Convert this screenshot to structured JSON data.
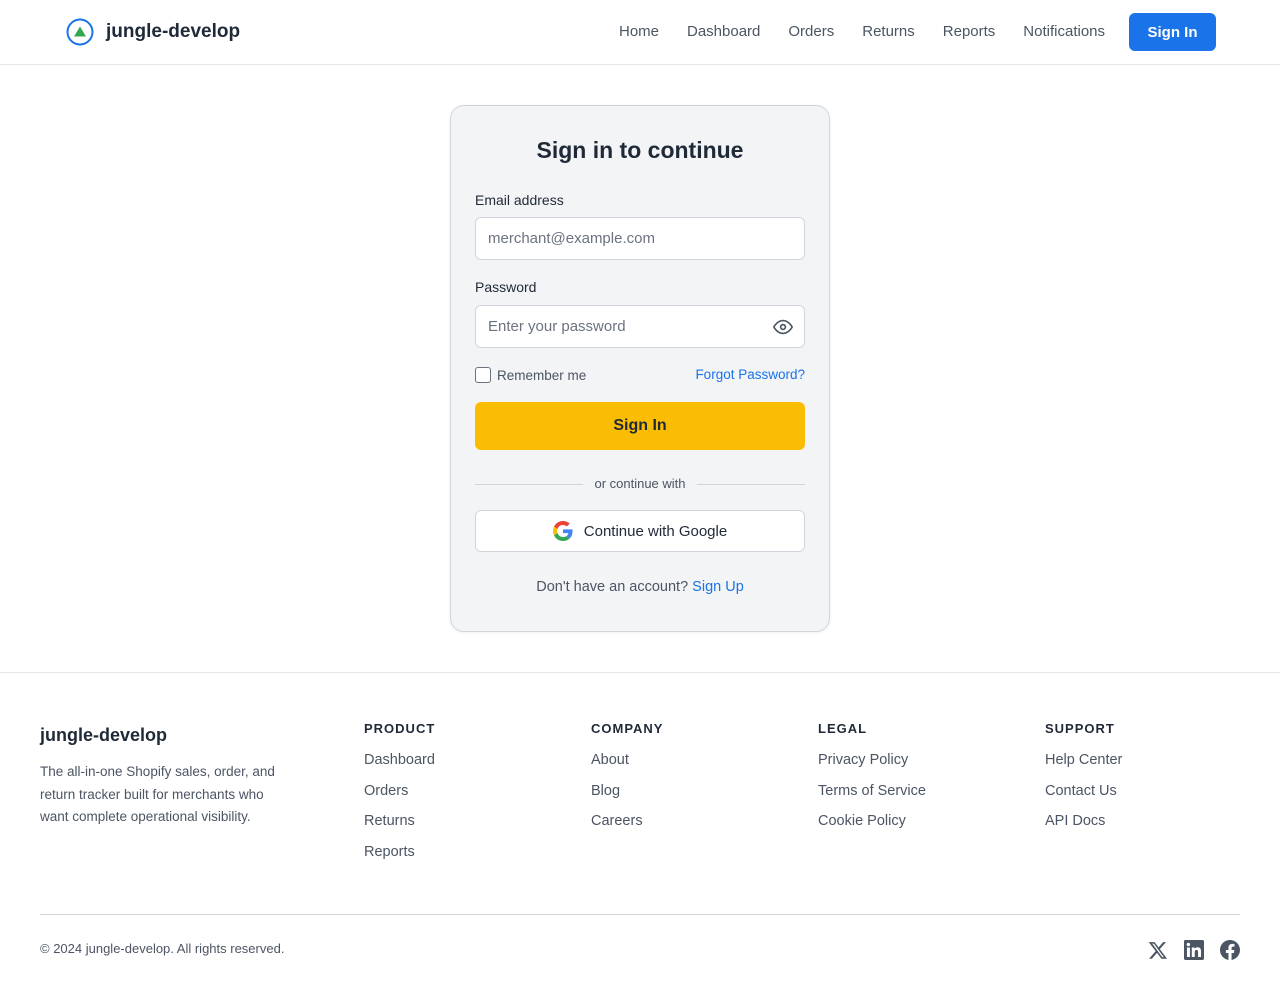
{
  "brand": {
    "name": "jungle-develop",
    "logo_icon": "triangle-circle-logo-icon"
  },
  "nav": {
    "items": [
      "Home",
      "Dashboard",
      "Orders",
      "Returns",
      "Reports",
      "Notifications"
    ],
    "signin_label": "Sign In"
  },
  "login": {
    "title": "Sign in to continue",
    "email_label": "Email address",
    "email_placeholder": "merchant@example.com",
    "password_label": "Password",
    "password_placeholder": "Enter your password",
    "password_toggle_icon": "eye-icon",
    "remember_label": "Remember me",
    "forgot_label": "Forgot Password?",
    "submit_label": "Sign In",
    "divider_text": "or continue with",
    "google_label": "Continue with Google",
    "signup_prompt": "Don't have an account?",
    "signup_link": "Sign Up"
  },
  "footer": {
    "brand": "jungle-develop",
    "description": "The all-in-one Shopify sales, order, and return tracker built for merchants who want complete operational visibility.",
    "columns": [
      {
        "title": "PRODUCT",
        "links": [
          "Dashboard",
          "Orders",
          "Returns",
          "Reports"
        ]
      },
      {
        "title": "COMPANY",
        "links": [
          "About",
          "Blog",
          "Careers"
        ]
      },
      {
        "title": "LEGAL",
        "links": [
          "Privacy Policy",
          "Terms of Service",
          "Cookie Policy"
        ]
      },
      {
        "title": "SUPPORT",
        "links": [
          "Help Center",
          "Contact Us",
          "API Docs"
        ]
      }
    ],
    "copyright": "© 2024 jungle-develop. All rights reserved.",
    "social_icons": [
      "x-icon",
      "linkedin-icon",
      "facebook-icon"
    ]
  },
  "colors": {
    "primary_blue": "#1a73e8",
    "signin_yellow": "#fbbc04",
    "logo_green": "#34a853",
    "card_bg": "#f3f4f6",
    "text_dark": "#1f2937",
    "text_muted": "#4b5563"
  }
}
